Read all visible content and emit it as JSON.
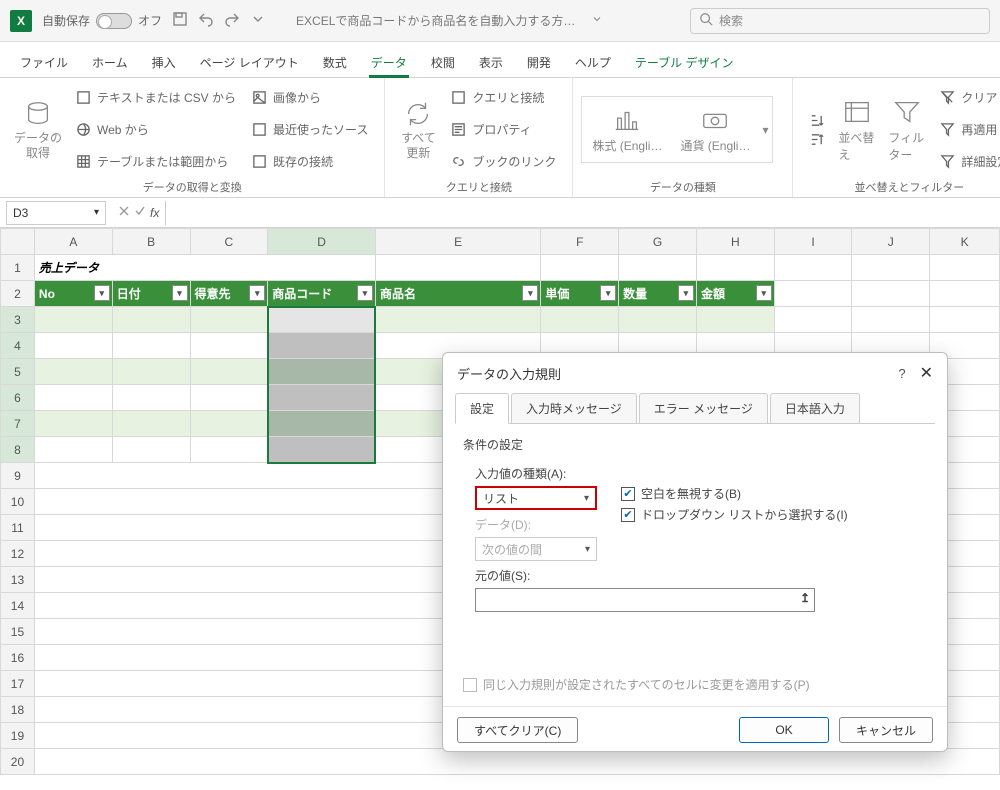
{
  "titlebar": {
    "autosave_label": "自動保存",
    "autosave_state": "オフ",
    "doc_title": "EXCELで商品コードから商品名を自動入力する方…",
    "search_placeholder": "検索"
  },
  "tabs": [
    "ファイル",
    "ホーム",
    "挿入",
    "ページ レイアウト",
    "数式",
    "データ",
    "校閲",
    "表示",
    "開発",
    "ヘルプ",
    "テーブル デザイン"
  ],
  "active_tab_index": 5,
  "ribbon": {
    "g1": {
      "big": "データの\n取得",
      "small": [
        "テキストまたは CSV から",
        "Web から",
        "テーブルまたは範囲から",
        "画像から",
        "最近使ったソース",
        "既存の接続"
      ],
      "label": "データの取得と変換"
    },
    "g2": {
      "big": "すべて\n更新",
      "small": [
        "クエリと接続",
        "プロパティ",
        "ブックのリンク"
      ],
      "label": "クエリと接続"
    },
    "g3": {
      "btn1": "株式 (Engli…",
      "btn2": "通貨 (Engli…",
      "label": "データの種類"
    },
    "g4": {
      "btn": "並べ替え",
      "filter": "フィルター",
      "small": [
        "クリア",
        "再適用",
        "詳細設定"
      ],
      "label": "並べ替えとフィルター"
    }
  },
  "name_box": "D3",
  "cols": [
    "",
    "A",
    "B",
    "C",
    "D",
    "E",
    "F",
    "G",
    "H",
    "I",
    "J",
    "K"
  ],
  "rows": [
    "1",
    "2",
    "3",
    "4",
    "5",
    "6",
    "7",
    "8",
    "9",
    "10",
    "11",
    "12",
    "13",
    "14",
    "15",
    "16",
    "17",
    "18",
    "19",
    "20"
  ],
  "title_text": "売上データ",
  "headers": [
    "No",
    "日付",
    "得意先",
    "商品コード",
    "商品名",
    "単価",
    "数量",
    "金額"
  ],
  "dialog": {
    "title": "データの入力規則",
    "tabs": [
      "設定",
      "入力時メッセージ",
      "エラー メッセージ",
      "日本語入力"
    ],
    "section": "条件の設定",
    "field_type_label": "入力値の種類(A):",
    "field_type_value": "リスト",
    "chk_blank": "空白を無視する(B)",
    "chk_dropdown": "ドロップダウン リストから選択する(I)",
    "field_data_label": "データ(D):",
    "field_data_value": "次の値の間",
    "field_source_label": "元の値(S):",
    "field_source_value": "",
    "chk_apply": "同じ入力規則が設定されたすべてのセルに変更を適用する(P)",
    "btn_clear": "すべてクリア(C)",
    "btn_ok": "OK",
    "btn_cancel": "キャンセル"
  }
}
